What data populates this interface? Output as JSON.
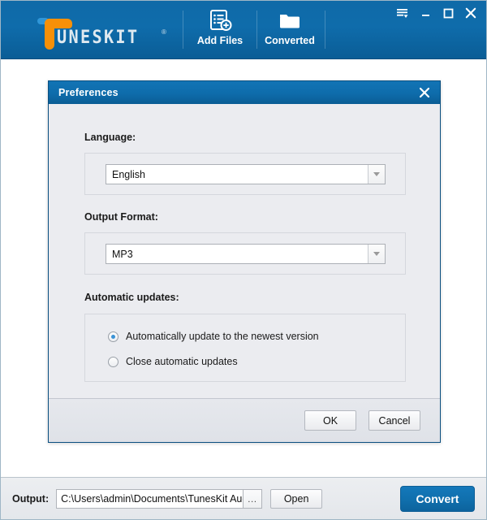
{
  "app": {
    "logo_text": "UNESKIT",
    "logo_tm": "®",
    "brand_orange": "#f79008",
    "brand_blue": "#0f6caa"
  },
  "toolbar": {
    "items": [
      {
        "label": "Add Files",
        "icon": "add-files-icon"
      },
      {
        "label": "Converted",
        "icon": "folder-icon"
      }
    ]
  },
  "window_controls": {
    "menu": "menu-icon",
    "minimize": "minimize-icon",
    "maximize": "maximize-icon",
    "close": "close-icon"
  },
  "dialog": {
    "title": "Preferences",
    "close_label": "✕",
    "language": {
      "label": "Language:",
      "value": "English"
    },
    "output_format": {
      "label": "Output Format:",
      "value": "MP3"
    },
    "automatic_updates": {
      "label": "Automatic updates:",
      "options": [
        {
          "label": "Automatically update to the newest version",
          "checked": true
        },
        {
          "label": "Close automatic updates",
          "checked": false
        }
      ]
    },
    "ok_label": "OK",
    "cancel_label": "Cancel"
  },
  "bottom_bar": {
    "output_label": "Output:",
    "output_path": "C:\\Users\\admin\\Documents\\TunesKit Audio",
    "browse_label": "…",
    "open_label": "Open",
    "convert_label": "Convert"
  }
}
